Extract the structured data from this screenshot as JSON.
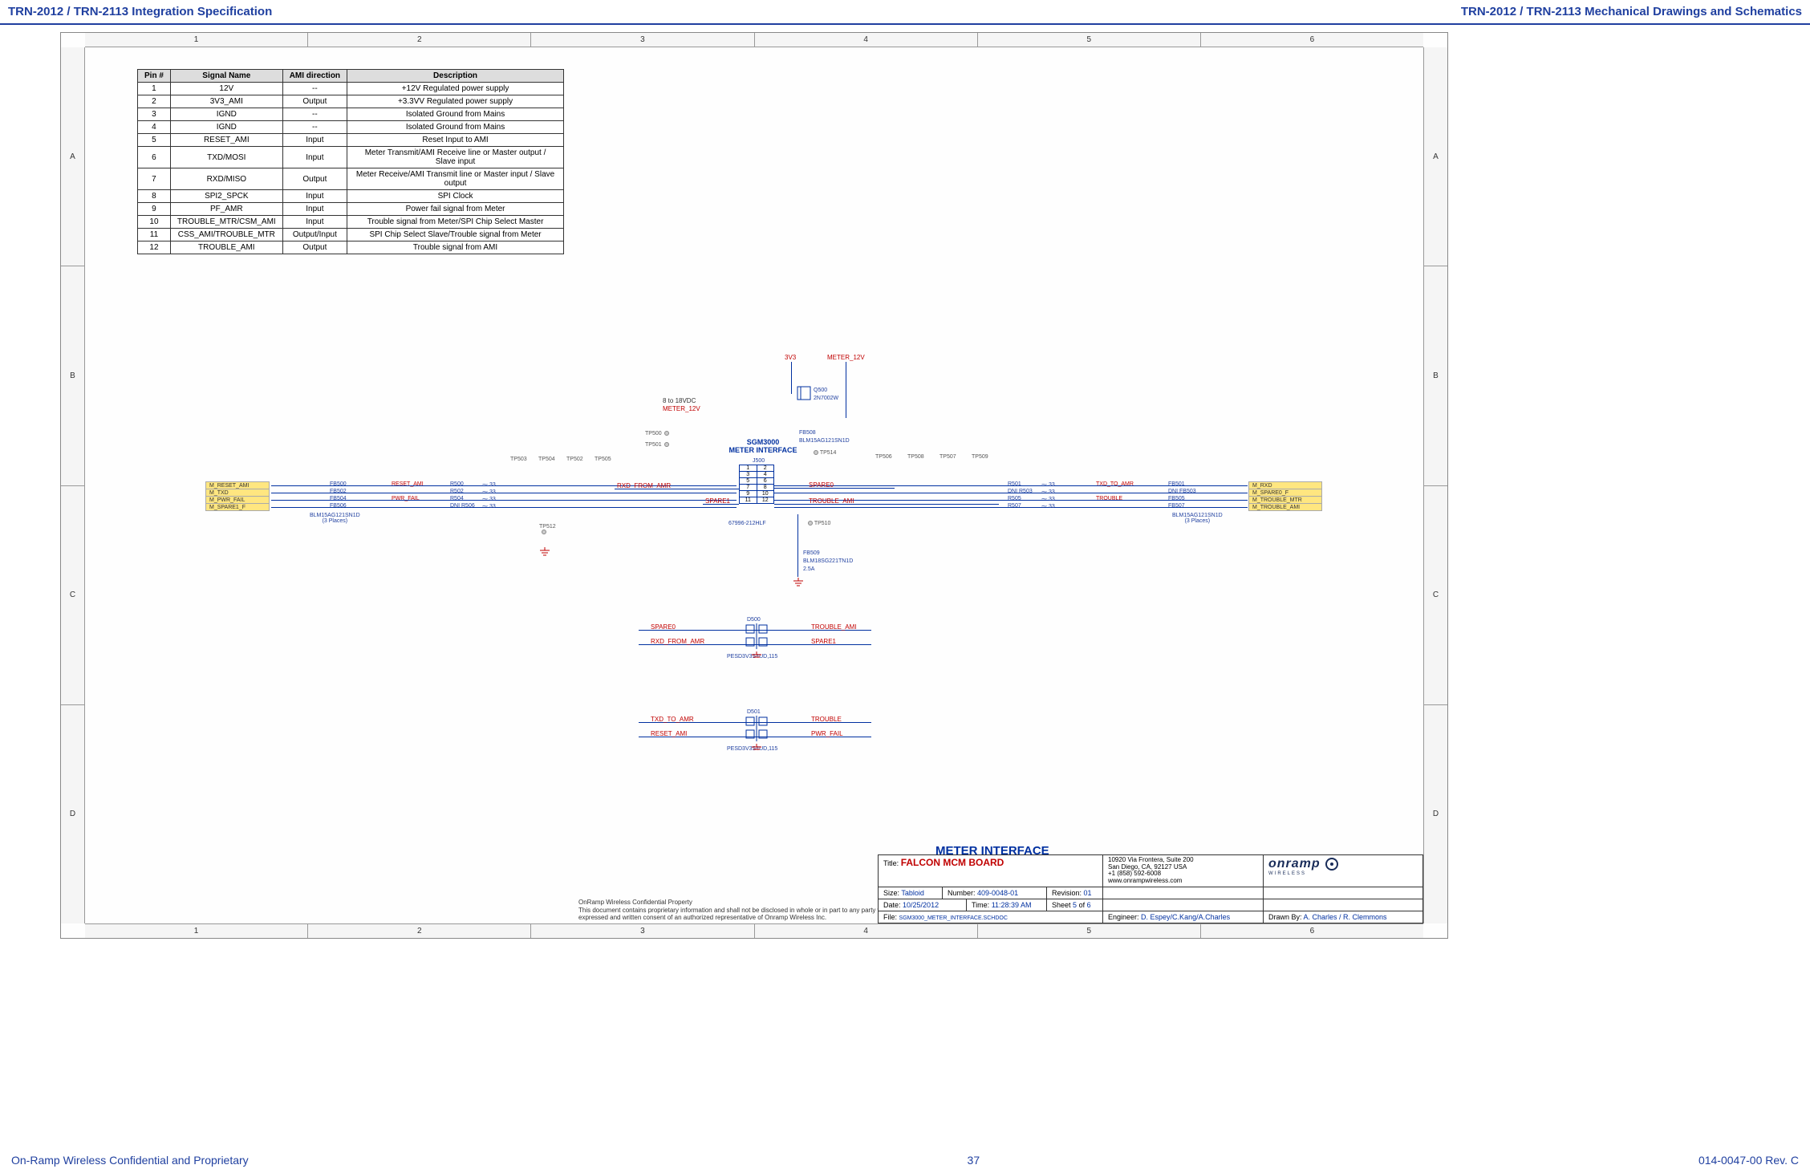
{
  "header": {
    "left": "TRN-2012 / TRN-2113 Integration Specification",
    "right": "TRN-2012 / TRN-2113 Mechanical Drawings and Schematics"
  },
  "footer": {
    "left": "On-Ramp Wireless Confidential and Proprietary",
    "center": "37",
    "right": "014-0047-00 Rev. C"
  },
  "ruler_cols": [
    "1",
    "2",
    "3",
    "4",
    "5",
    "6"
  ],
  "ruler_rows": [
    "A",
    "B",
    "C",
    "D"
  ],
  "pin_table": {
    "headers": [
      "Pin #",
      "Signal Name",
      "AMI direction",
      "Description"
    ],
    "rows": [
      [
        "1",
        "12V",
        "--",
        "+12V Regulated power supply"
      ],
      [
        "2",
        "3V3_AMI",
        "Output",
        "+3.3VV Regulated power supply"
      ],
      [
        "3",
        "IGND",
        "--",
        "Isolated Ground from Mains"
      ],
      [
        "4",
        "IGND",
        "--",
        "Isolated Ground from Mains"
      ],
      [
        "5",
        "RESET_AMI",
        "Input",
        "Reset Input to AMI"
      ],
      [
        "6",
        "TXD/MOSI",
        "Input",
        "Meter Transmit/AMI Receive line or Master output / Slave input"
      ],
      [
        "7",
        "RXD/MISO",
        "Output",
        "Meter Receive/AMI Transmit line or Master input / Slave output"
      ],
      [
        "8",
        "SPI2_SPCK",
        "Input",
        "SPI Clock"
      ],
      [
        "9",
        "PF_AMR",
        "Input",
        "Power fail signal from Meter"
      ],
      [
        "10",
        "TROUBLE_MTR/CSM_AMI",
        "Input",
        "Trouble signal from Meter/SPI Chip Select Master"
      ],
      [
        "11",
        "CSS_AMI/TROUBLE_MTR",
        "Output/Input",
        "SPI Chip Select Slave/Trouble signal from Meter"
      ],
      [
        "12",
        "TROUBLE_AMI",
        "Output",
        "Trouble signal from AMI"
      ]
    ]
  },
  "schematic": {
    "title": "SGM3000",
    "subtitle": "METER INTERFACE",
    "conn_ref": "J500",
    "conn_part": "67996-212HLF",
    "power_in_label": "8 to 18VDC",
    "power_in_net": "METER_12V",
    "q500": {
      "ref": "Q500",
      "part": "2N7002W"
    },
    "fb508": {
      "ref": "FB508",
      "part": "BLM15AG121SN1D"
    },
    "fb509": {
      "ref": "FB509",
      "part": "BLM18SG221TN1D",
      "rating": "2.5A"
    },
    "v3v3": "3V3",
    "meter12v": "METER_12V",
    "tp": {
      "tp500": "TP500",
      "tp501": "TP501",
      "tp502": "TP502",
      "tp503": "TP503",
      "tp504": "TP504",
      "tp505": "TP505",
      "tp506": "TP506",
      "tp507": "TP507",
      "tp508": "TP508",
      "tp509": "TP509",
      "tp510": "TP510",
      "tp512": "TP512",
      "tp514": "TP514"
    },
    "left_nets": [
      "M_RESET_AMI",
      "M_TXD",
      "M_PWR_FAIL",
      "M_SPARE1_F"
    ],
    "left_fbs": [
      "FB500",
      "FB502",
      "FB504",
      "FB506"
    ],
    "left_rs": [
      {
        "ref": "R500",
        "val": "33",
        "sig": "RESET_AMI"
      },
      {
        "ref": "R502",
        "val": "33",
        "sig": ""
      },
      {
        "ref": "R504",
        "val": "33",
        "sig": "PWR_FAIL"
      },
      {
        "ref": "R506",
        "val": "33",
        "sig": ""
      }
    ],
    "left_dni_prefix": "DNI",
    "left_bead_note": "BLM15AG121SN1D\n(3 Places)",
    "rxd_from_amr": "RXD_FROM_AMR",
    "spare1": "SPARE1",
    "spare0": "SPARE0",
    "trouble_ami": "TROUBLE_AMI",
    "right_rs": [
      {
        "ref": "R501",
        "val": "33",
        "pre": "",
        "sig": "TXD_TO_AMR"
      },
      {
        "ref": "R503",
        "val": "33",
        "pre": "DNI",
        "sig": ""
      },
      {
        "ref": "R505",
        "val": "33",
        "pre": "",
        "sig": "TROUBLE"
      },
      {
        "ref": "R507",
        "val": "33",
        "pre": "",
        "sig": ""
      }
    ],
    "right_fbs": [
      "FB501",
      "FB503",
      "FB505",
      "FB507"
    ],
    "right_dni_prefix": "DNI",
    "right_nets": [
      "M_RXD",
      "M_SPARE0_F",
      "M_TROUBLE_MTR",
      "M_TROUBLE_AMI"
    ],
    "right_bead_note": "BLM15AG121SN1D\n(3 Places)"
  },
  "esd_blocks": [
    {
      "ref": "D500",
      "part": "PESD3V3S4UD,115",
      "l1": "SPARE0",
      "r1": "TROUBLE_AMI",
      "l2": "RXD_FROM_AMR",
      "r2": "SPARE1"
    },
    {
      "ref": "D501",
      "part": "PESD3V3S4UD,115",
      "l1": "TXD_TO_AMR",
      "r1": "TROUBLE",
      "l2": "RESET_AMI",
      "r2": "PWR_FAIL"
    }
  ],
  "sheet_title_big": "METER INTERFACE",
  "titleblock": {
    "title_label": "Title:",
    "title": "FALCON MCM BOARD",
    "size_label": "Size:",
    "size": "Tabloid",
    "number_label": "Number:",
    "number": "409-0048-01",
    "rev_label": "Revision:",
    "rev": "01",
    "date_label": "Date:",
    "date": "10/25/2012",
    "time_label": "Time:",
    "time": "11:28:39 AM",
    "sheet_label": "Sheet",
    "sheet": "5",
    "of_label": "of",
    "sheet_total": "6",
    "file_label": "File:",
    "file": "SGM3000_METER_INTERFACE.SCHDOC",
    "eng_label": "Engineer:",
    "eng": "D. Espey/C.Kang/A.Charles",
    "drawn_label": "Drawn By:",
    "drawn": "A. Charles / R. Clemmons",
    "addr1": "10920 Via Frontera, Suite 200",
    "addr2": "San Diego, CA, 92127 USA",
    "addr3": "+1 (858) 592-6008",
    "addr4": "www.onrampwireless.com"
  },
  "confidential": {
    "line1": "OnRamp Wireless Confidential Property",
    "line2": "This document contains proprietary information and shall not be disclosed in whole or in part to any party without the expressed and written consent of an authorized representative of Onramp Wireless Inc."
  },
  "logo": {
    "name": "onramp",
    "sub": "WIRELESS"
  }
}
